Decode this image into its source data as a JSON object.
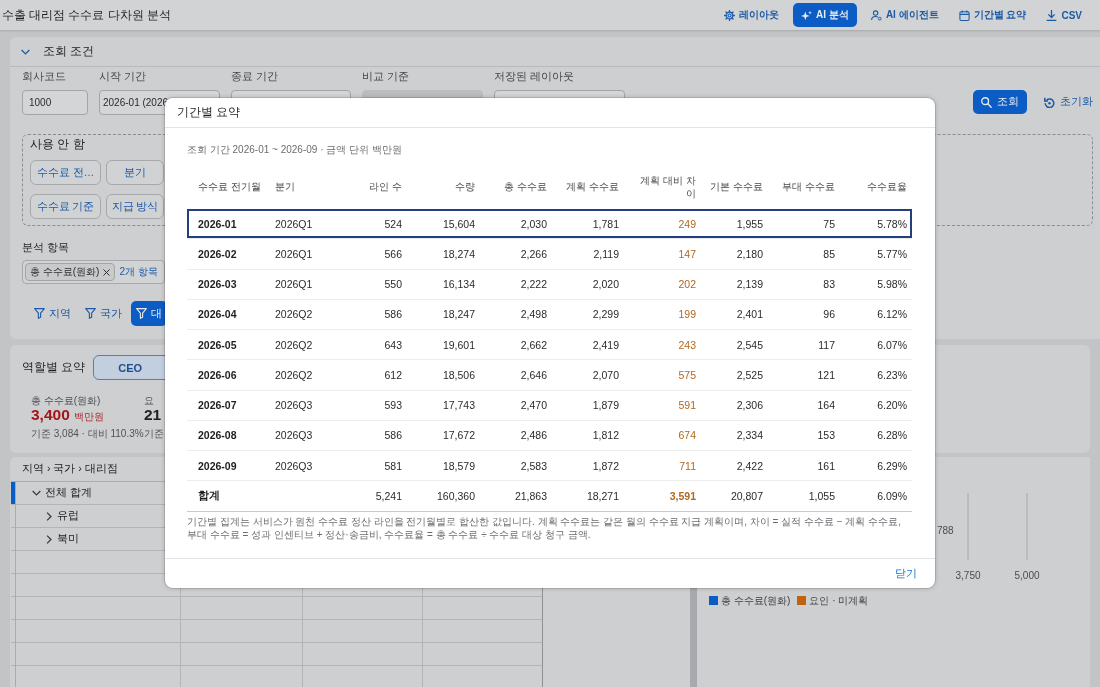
{
  "app_bar": {
    "title": "수출 대리점 수수료 다차원 분석",
    "actions": [
      {
        "label": "레이아웃",
        "kind": "plain"
      },
      {
        "label": "AI 분석",
        "kind": "primary"
      },
      {
        "label": "AI 에이전트",
        "kind": "plain"
      },
      {
        "label": "기간별 요약",
        "kind": "plain"
      },
      {
        "label": "CSV",
        "kind": "plain"
      }
    ]
  },
  "query_panel": {
    "title": "조회 조건",
    "expanded": true,
    "fields": [
      {
        "label": "회사코드",
        "value": "1000",
        "disabled": false
      },
      {
        "label": "시작 기간",
        "value": "2026-01 (2026",
        "disabled": false
      },
      {
        "label": "종료 기간",
        "disabled": false
      },
      {
        "label": "비교 기준",
        "disabled": true
      },
      {
        "label": "저장된 레이아웃",
        "disabled": false
      }
    ],
    "search_button": "조회",
    "reset_button": "초기화",
    "unused_group": {
      "title": "사용 안 함",
      "chips": [
        "수수료 전…",
        "분기",
        "수수료 기준",
        "지급 방식"
      ]
    },
    "measures": {
      "label": "분석 항목",
      "chips": [
        "총 수수료(원화)"
      ],
      "more_link": "2개 항목"
    },
    "dimension_buttons": [
      {
        "label": "지역",
        "selected": false
      },
      {
        "label": "국가",
        "selected": false
      },
      {
        "label": "대",
        "selected": true
      }
    ]
  },
  "role_summary": {
    "title": "역할별 요약",
    "roles": [
      {
        "label": "CEO",
        "selected": true
      }
    ],
    "kpis": [
      {
        "label": "총 수수료(원화)",
        "value": "3,400",
        "unit": "백만원",
        "note": "기준 3,084 · 대비 110.3%",
        "kind": "alert"
      },
      {
        "label": "요",
        "value": "21",
        "note": "기준",
        "kind": "plain"
      }
    ]
  },
  "tree": {
    "header": "지역 › 국가 › 대리점",
    "items": [
      {
        "label": "전체 합계",
        "expanded": true,
        "selected": true,
        "children": [
          {
            "label": "유럽",
            "expanded": false,
            "selected": false
          },
          {
            "label": "북미",
            "expanded": false,
            "selected": false
          }
        ]
      }
    ]
  },
  "chart": {
    "axis_ticks": [
      "3,750",
      "5,000"
    ],
    "data_label": "788",
    "legend": [
      {
        "label": "총 수수료(원화)",
        "color": "#0b5cc4"
      },
      {
        "label": "요인 · 미계획",
        "color": "#c0620f"
      }
    ]
  },
  "period_summary_dialog": {
    "title": "기간별 요약",
    "subtitle": "조회 기간 2026-01 ~ 2026-09 · 금액 단위 백만원",
    "columns": [
      {
        "label": "수수료 전기월",
        "kind": "key"
      },
      {
        "label": "분기",
        "kind": "text"
      },
      {
        "label": "라인 수",
        "kind": "number"
      },
      {
        "label": "수량",
        "kind": "number"
      },
      {
        "label": "총 수수료",
        "kind": "number"
      },
      {
        "label": "계획 수수료",
        "kind": "number"
      },
      {
        "label": "계획 대비 차이",
        "kind": "variance"
      },
      {
        "label": "기본 수수료",
        "kind": "number"
      },
      {
        "label": "부대 수수료",
        "kind": "number"
      },
      {
        "label": "수수료율",
        "kind": "number"
      }
    ],
    "rows": [
      {
        "cells": [
          "2026-01",
          "2026Q1",
          "524",
          "15,604",
          "2,030",
          "1,781",
          "249",
          "1,955",
          "75",
          "5.78%"
        ],
        "selected": true
      },
      {
        "cells": [
          "2026-02",
          "2026Q1",
          "566",
          "18,274",
          "2,266",
          "2,119",
          "147",
          "2,180",
          "85",
          "5.77%"
        ],
        "selected": false
      },
      {
        "cells": [
          "2026-03",
          "2026Q1",
          "550",
          "16,134",
          "2,222",
          "2,020",
          "202",
          "2,139",
          "83",
          "5.98%"
        ],
        "selected": false
      },
      {
        "cells": [
          "2026-04",
          "2026Q2",
          "586",
          "18,247",
          "2,498",
          "2,299",
          "199",
          "2,401",
          "96",
          "6.12%"
        ],
        "selected": false
      },
      {
        "cells": [
          "2026-05",
          "2026Q2",
          "643",
          "19,601",
          "2,662",
          "2,419",
          "243",
          "2,545",
          "117",
          "6.07%"
        ],
        "selected": false
      },
      {
        "cells": [
          "2026-06",
          "2026Q2",
          "612",
          "18,506",
          "2,646",
          "2,070",
          "575",
          "2,525",
          "121",
          "6.23%"
        ],
        "selected": false
      },
      {
        "cells": [
          "2026-07",
          "2026Q3",
          "593",
          "17,743",
          "2,470",
          "1,879",
          "591",
          "2,306",
          "164",
          "6.20%"
        ],
        "selected": false
      },
      {
        "cells": [
          "2026-08",
          "2026Q3",
          "586",
          "17,672",
          "2,486",
          "1,812",
          "674",
          "2,334",
          "153",
          "6.28%"
        ],
        "selected": false
      },
      {
        "cells": [
          "2026-09",
          "2026Q3",
          "581",
          "18,579",
          "2,583",
          "1,872",
          "711",
          "2,422",
          "161",
          "6.29%"
        ],
        "selected": false
      }
    ],
    "total_row": {
      "label": "합계",
      "cells": [
        "5,241",
        "160,360",
        "21,863",
        "18,271",
        "3,591",
        "20,807",
        "1,055",
        "6.09%"
      ]
    },
    "footnote": "기간별 집계는 서비스가 원천 수수료 정산 라인을 전기월별로 합산한 값입니다. 계획 수수료는 같은 월의 수수료 지급 계획이며, 차이 = 실적 수수료 − 계획 수수료, 부대 수수료 = 성과 인센티브 + 정산·송금비, 수수료율 = 총 수수료 ÷ 수수료 대상 청구 금액.",
    "close_button": "닫기"
  }
}
